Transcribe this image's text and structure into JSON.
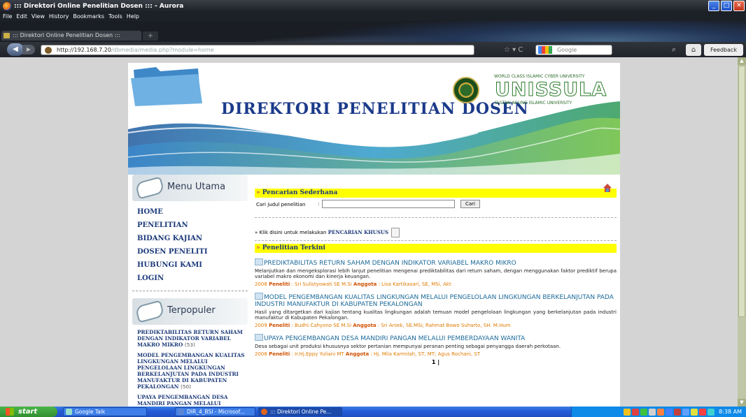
{
  "window": {
    "title": "::: Direktori Online Penelitian Dosen ::: - Aurora"
  },
  "menubar": [
    "File",
    "Edit",
    "View",
    "History",
    "Bookmarks",
    "Tools",
    "Help"
  ],
  "tab": {
    "label": "::: Direktori Online Penelitian Dosen :::",
    "new_tab": "+"
  },
  "nav": {
    "url_host": "http://192.168.7.20",
    "url_path": "/dbmedia/media.php?module=home",
    "search_placeholder": "Google",
    "feedback": "Feedback"
  },
  "banner": {
    "title": "DIREKTORI PENELITIAN DOSEN",
    "uni_tagline": "WORLD CLASS ISLAMIC CYBER UNIVERSITY",
    "uni_name": "UNISSULA",
    "uni_sub": "SULTAN AGUNG ISLAMIC UNIVERSITY"
  },
  "sidebar": {
    "menu_title": "Menu Utama",
    "menu": [
      "HOME",
      "PENELITIAN",
      "BIDANG KAJIAN",
      "DOSEN PENELITI",
      "HUBUNGI KAMI",
      "LOGIN"
    ],
    "popular_title": "Terpopuler",
    "popular": [
      {
        "title": "PREDIKTABILITAS RETURN SAHAM DENGAN INDIKATOR VARIABEL MAKRO MIKRO",
        "count": "(53)"
      },
      {
        "title": "MODEL PENGEMBANGAN KUALITAS LINGKUNGAN MELALUI PENGELOLAAN LINGKUNGAN BERKELANJUTAN PADA INDUSTRI MANUFAKTUR DI KABUPATEN PEKALONGAN",
        "count": "(50)"
      },
      {
        "title": "UPAYA PENGEMBANGAN DESA MANDIRI PANGAN MELALUI",
        "count": ""
      }
    ]
  },
  "main": {
    "simple_search_title": "Pencarian Sederhana",
    "search_label": "Cari judul penelitian",
    "search_colon": ":",
    "search_button": "Cari",
    "special_prefix": "» Klik disini untuk melakukan",
    "special_link": "PENCARIAN KHUSUS",
    "latest_title": "Penelitian Terkini",
    "articles": [
      {
        "title": "PREDIKTABILITAS RETURN SAHAM DENGAN INDIKATOR VARIABEL MAKRO MIKRO",
        "desc": "Melanjutkan dan mengeksplorasi lebih lanjut penelitian mengenai prediktabilitas dari return saham, dengan menggunakan faktor prediktif berupa variabel makro ekonomi dan kinerja keuangan.",
        "year": "2008",
        "peneliti": "Sri Sulistyowati SE M.Si",
        "anggota": "Lisa Kartikasari, SE, MSi, Akt"
      },
      {
        "title": "MODEL PENGEMBANGAN KUALITAS LINGKUNGAN MELALUI PENGELOLAAN LINGKUNGAN BERKELANJUTAN PADA INDUSTRI MANUFAKTUR DI KABUPATEN PEKALONGAN",
        "desc": "Hasil yang ditargetkan dari kajian tentang kualitas lingkungan adalah temuan model pengelolaan lingkungan yang berkelanjutan pada industri manufaktur di Kabupaten Pekalongan.",
        "year": "2009",
        "peneliti": "Budhi Cahyono SE M.Si",
        "anggota": "Sri Aniek, SE.MSi; Rahmat Bowo Suharto, SH. M.Hum"
      },
      {
        "title": "UPAYA PENGEMBANGAN DESA MANDIRI PANGAN MELALUI PEMBERDAYAAN WANITA",
        "desc": "Desa sebagai unit produksi khususnya sektor pertanian mempunyai peranan penting sebagai penyangga daerah perkotaan.",
        "year": "2008",
        "peneliti": "Ir.Hj.Eppy Yuliani MT",
        "anggota": "Hj. Mila Karmilah, ST, MT; Agus Rochani, ST"
      }
    ],
    "label_peneliti": "Peneliti",
    "label_anggota": "Anggota",
    "pager": "1 |"
  },
  "taskbar": {
    "start": "start",
    "tasks": [
      "Google Talk",
      "DIR_4_BSI - Microsof...",
      "::: Direktori Online Pe..."
    ],
    "clock": "8:38 AM"
  }
}
